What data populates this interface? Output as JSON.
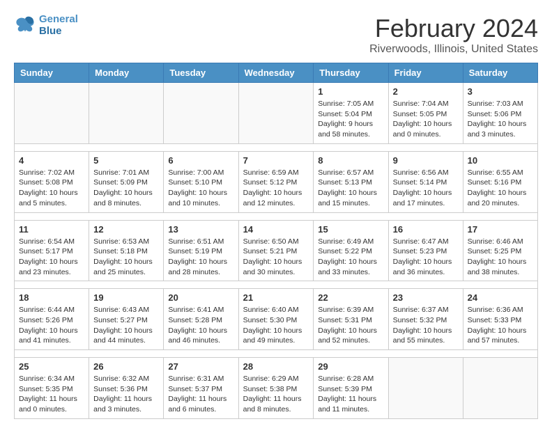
{
  "logo": {
    "line1": "General",
    "line2": "Blue"
  },
  "title": "February 2024",
  "location": "Riverwoods, Illinois, United States",
  "days_of_week": [
    "Sunday",
    "Monday",
    "Tuesday",
    "Wednesday",
    "Thursday",
    "Friday",
    "Saturday"
  ],
  "weeks": [
    [
      {
        "day": "",
        "info": ""
      },
      {
        "day": "",
        "info": ""
      },
      {
        "day": "",
        "info": ""
      },
      {
        "day": "",
        "info": ""
      },
      {
        "day": "1",
        "info": "Sunrise: 7:05 AM\nSunset: 5:04 PM\nDaylight: 9 hours\nand 58 minutes."
      },
      {
        "day": "2",
        "info": "Sunrise: 7:04 AM\nSunset: 5:05 PM\nDaylight: 10 hours\nand 0 minutes."
      },
      {
        "day": "3",
        "info": "Sunrise: 7:03 AM\nSunset: 5:06 PM\nDaylight: 10 hours\nand 3 minutes."
      }
    ],
    [
      {
        "day": "4",
        "info": "Sunrise: 7:02 AM\nSunset: 5:08 PM\nDaylight: 10 hours\nand 5 minutes."
      },
      {
        "day": "5",
        "info": "Sunrise: 7:01 AM\nSunset: 5:09 PM\nDaylight: 10 hours\nand 8 minutes."
      },
      {
        "day": "6",
        "info": "Sunrise: 7:00 AM\nSunset: 5:10 PM\nDaylight: 10 hours\nand 10 minutes."
      },
      {
        "day": "7",
        "info": "Sunrise: 6:59 AM\nSunset: 5:12 PM\nDaylight: 10 hours\nand 12 minutes."
      },
      {
        "day": "8",
        "info": "Sunrise: 6:57 AM\nSunset: 5:13 PM\nDaylight: 10 hours\nand 15 minutes."
      },
      {
        "day": "9",
        "info": "Sunrise: 6:56 AM\nSunset: 5:14 PM\nDaylight: 10 hours\nand 17 minutes."
      },
      {
        "day": "10",
        "info": "Sunrise: 6:55 AM\nSunset: 5:16 PM\nDaylight: 10 hours\nand 20 minutes."
      }
    ],
    [
      {
        "day": "11",
        "info": "Sunrise: 6:54 AM\nSunset: 5:17 PM\nDaylight: 10 hours\nand 23 minutes."
      },
      {
        "day": "12",
        "info": "Sunrise: 6:53 AM\nSunset: 5:18 PM\nDaylight: 10 hours\nand 25 minutes."
      },
      {
        "day": "13",
        "info": "Sunrise: 6:51 AM\nSunset: 5:19 PM\nDaylight: 10 hours\nand 28 minutes."
      },
      {
        "day": "14",
        "info": "Sunrise: 6:50 AM\nSunset: 5:21 PM\nDaylight: 10 hours\nand 30 minutes."
      },
      {
        "day": "15",
        "info": "Sunrise: 6:49 AM\nSunset: 5:22 PM\nDaylight: 10 hours\nand 33 minutes."
      },
      {
        "day": "16",
        "info": "Sunrise: 6:47 AM\nSunset: 5:23 PM\nDaylight: 10 hours\nand 36 minutes."
      },
      {
        "day": "17",
        "info": "Sunrise: 6:46 AM\nSunset: 5:25 PM\nDaylight: 10 hours\nand 38 minutes."
      }
    ],
    [
      {
        "day": "18",
        "info": "Sunrise: 6:44 AM\nSunset: 5:26 PM\nDaylight: 10 hours\nand 41 minutes."
      },
      {
        "day": "19",
        "info": "Sunrise: 6:43 AM\nSunset: 5:27 PM\nDaylight: 10 hours\nand 44 minutes."
      },
      {
        "day": "20",
        "info": "Sunrise: 6:41 AM\nSunset: 5:28 PM\nDaylight: 10 hours\nand 46 minutes."
      },
      {
        "day": "21",
        "info": "Sunrise: 6:40 AM\nSunset: 5:30 PM\nDaylight: 10 hours\nand 49 minutes."
      },
      {
        "day": "22",
        "info": "Sunrise: 6:39 AM\nSunset: 5:31 PM\nDaylight: 10 hours\nand 52 minutes."
      },
      {
        "day": "23",
        "info": "Sunrise: 6:37 AM\nSunset: 5:32 PM\nDaylight: 10 hours\nand 55 minutes."
      },
      {
        "day": "24",
        "info": "Sunrise: 6:36 AM\nSunset: 5:33 PM\nDaylight: 10 hours\nand 57 minutes."
      }
    ],
    [
      {
        "day": "25",
        "info": "Sunrise: 6:34 AM\nSunset: 5:35 PM\nDaylight: 11 hours\nand 0 minutes."
      },
      {
        "day": "26",
        "info": "Sunrise: 6:32 AM\nSunset: 5:36 PM\nDaylight: 11 hours\nand 3 minutes."
      },
      {
        "day": "27",
        "info": "Sunrise: 6:31 AM\nSunset: 5:37 PM\nDaylight: 11 hours\nand 6 minutes."
      },
      {
        "day": "28",
        "info": "Sunrise: 6:29 AM\nSunset: 5:38 PM\nDaylight: 11 hours\nand 8 minutes."
      },
      {
        "day": "29",
        "info": "Sunrise: 6:28 AM\nSunset: 5:39 PM\nDaylight: 11 hours\nand 11 minutes."
      },
      {
        "day": "",
        "info": ""
      },
      {
        "day": "",
        "info": ""
      }
    ]
  ]
}
